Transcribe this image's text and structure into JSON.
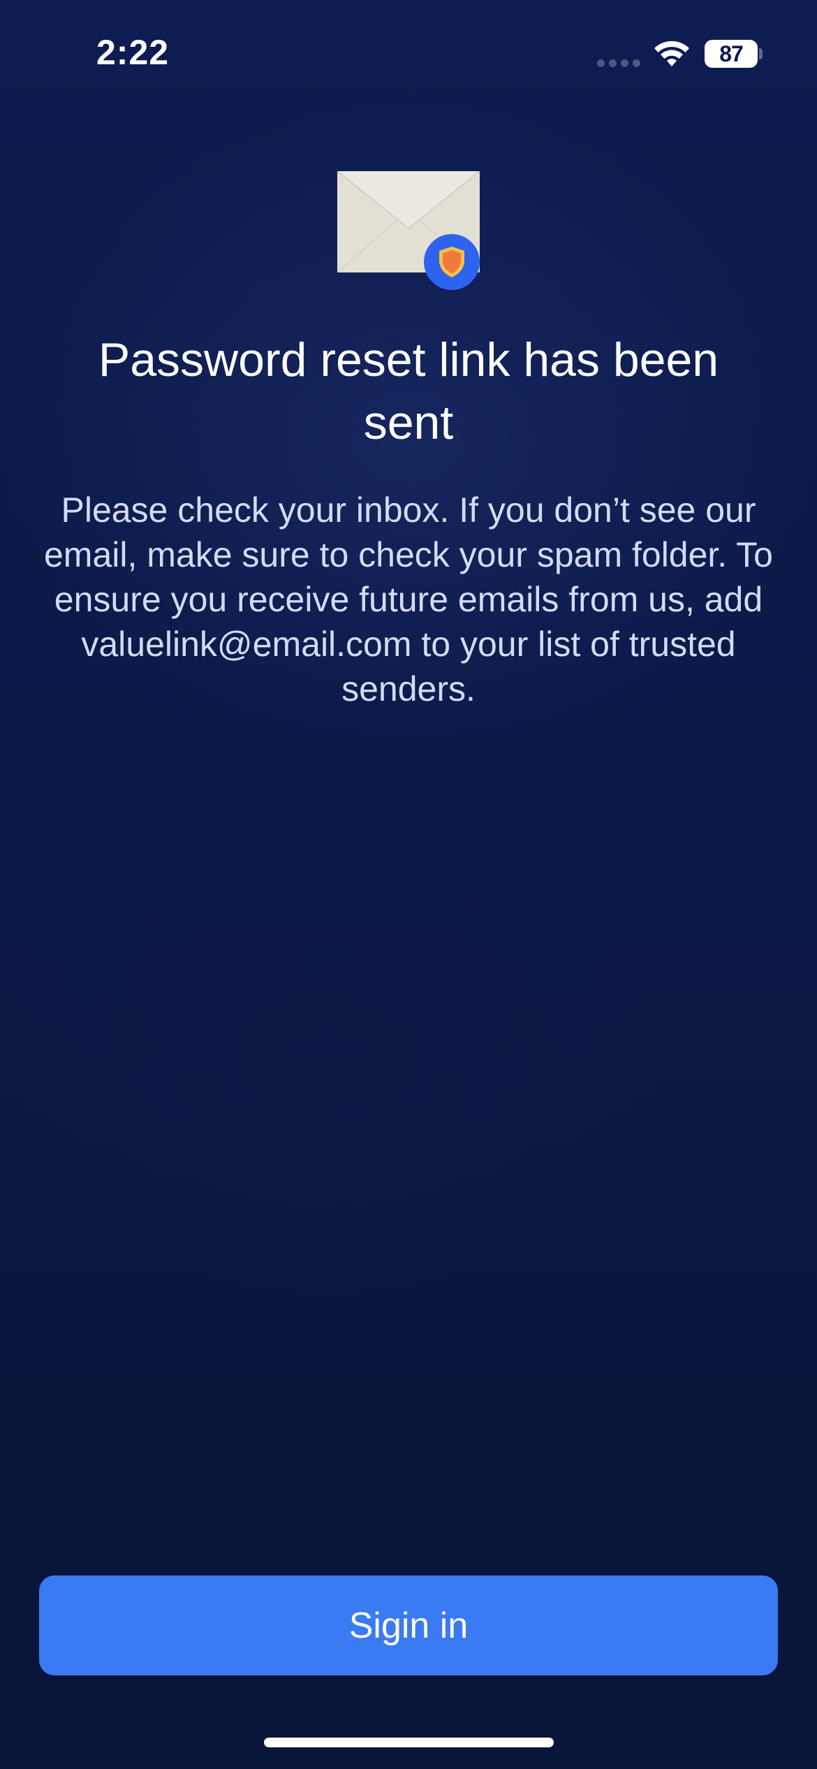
{
  "status_bar": {
    "time": "2:22",
    "battery_level": "87",
    "wifi_icon": "wifi-icon",
    "cellular_icon": "cellular-dots-icon"
  },
  "illustration": {
    "envelope_icon": "envelope-icon",
    "badge_icon": "shield-icon",
    "badge_color": "#2e63f0",
    "shield_color": "#f07a3a"
  },
  "content": {
    "title": "Password reset link has been sent",
    "message": "Please check your inbox. If you don’t see our email, make sure to check your spam folder. To ensure you receive future emails from us, add valuelink@email.com to your list of trusted senders."
  },
  "actions": {
    "signin_label": "Sigin in",
    "signin_color": "#3a7af3"
  }
}
